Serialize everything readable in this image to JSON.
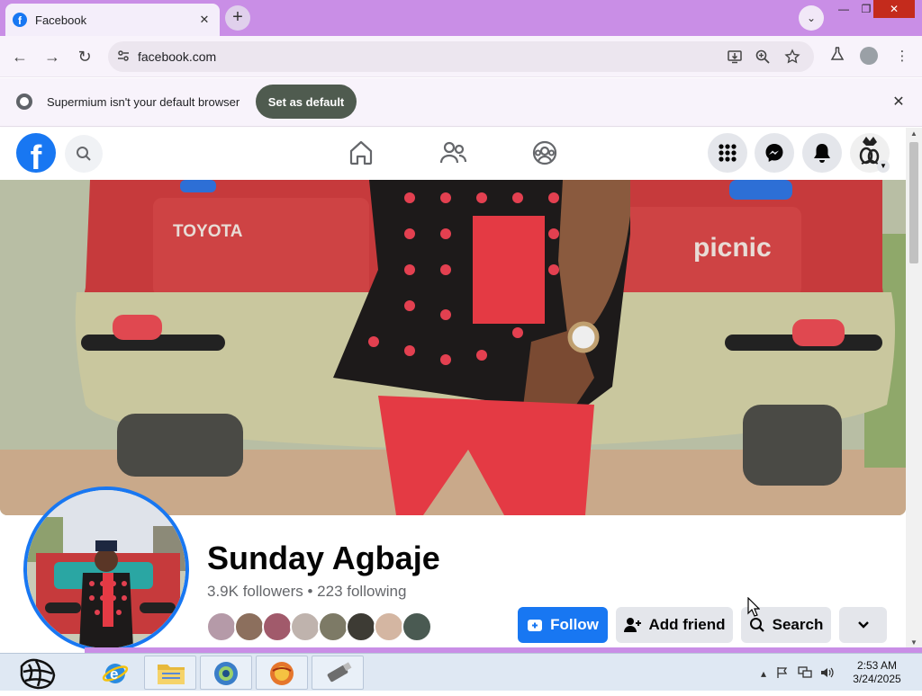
{
  "browser": {
    "tab_title": "Facebook",
    "tab_close": "✕",
    "new_tab": "+",
    "tab_dropdown": "⌄",
    "window": {
      "minimize": "—",
      "maximize": "❐",
      "close": "✕"
    },
    "nav": {
      "back": "←",
      "forward": "→",
      "reload": "↻"
    },
    "url": "facebook.com",
    "menu": "⋮"
  },
  "infobar": {
    "text": "Supermium isn't your default browser",
    "button": "Set as default",
    "close": "✕"
  },
  "facebook": {
    "brand_color": "#1877f2",
    "logo_letter": "f"
  },
  "profile": {
    "name": "Sunday Agbaje",
    "stats": "3.9K followers • 223 following",
    "cover_text_left": "TOYOTA",
    "cover_text_right": "picnic",
    "friend_avatar_colors": [
      "#b59aa8",
      "#8c6f5d",
      "#a15a6b",
      "#bfb3ad",
      "#7d7a66",
      "#3d3b34",
      "#d4b6a2",
      "#4a5a52"
    ]
  },
  "actions": {
    "follow": "Follow",
    "add_friend": "Add friend",
    "search": "Search",
    "more": "⌄"
  },
  "taskbar": {
    "time": "2:53 AM",
    "date": "3/24/2025"
  }
}
